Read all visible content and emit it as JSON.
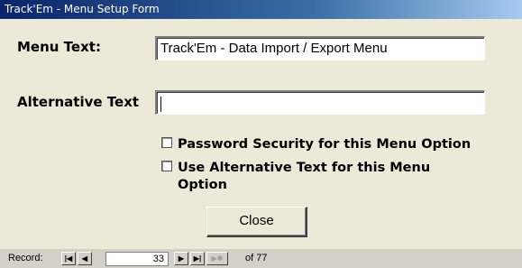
{
  "window": {
    "title": "Track'Em - Menu Setup Form"
  },
  "form": {
    "menu_text_label": "Menu Text:",
    "menu_text_value": "Track'Em - Data Import / Export Menu",
    "alt_text_label": "Alternative Text",
    "alt_text_value": "",
    "password_security_label": "Password Security for this Menu Option",
    "password_security_checked": false,
    "use_alt_text_label_line1": "Use Alternative Text for this Menu",
    "use_alt_text_label_line2": "Option",
    "use_alt_text_checked": false,
    "close_label": "Close"
  },
  "navigation": {
    "record_label": "Record:",
    "first_icon": "first-record-icon",
    "prev_icon": "previous-record-icon",
    "next_icon": "next-record-icon",
    "last_icon": "last-record-icon",
    "new_icon": "new-record-icon",
    "current_record": "33",
    "of_text": "of 77"
  }
}
